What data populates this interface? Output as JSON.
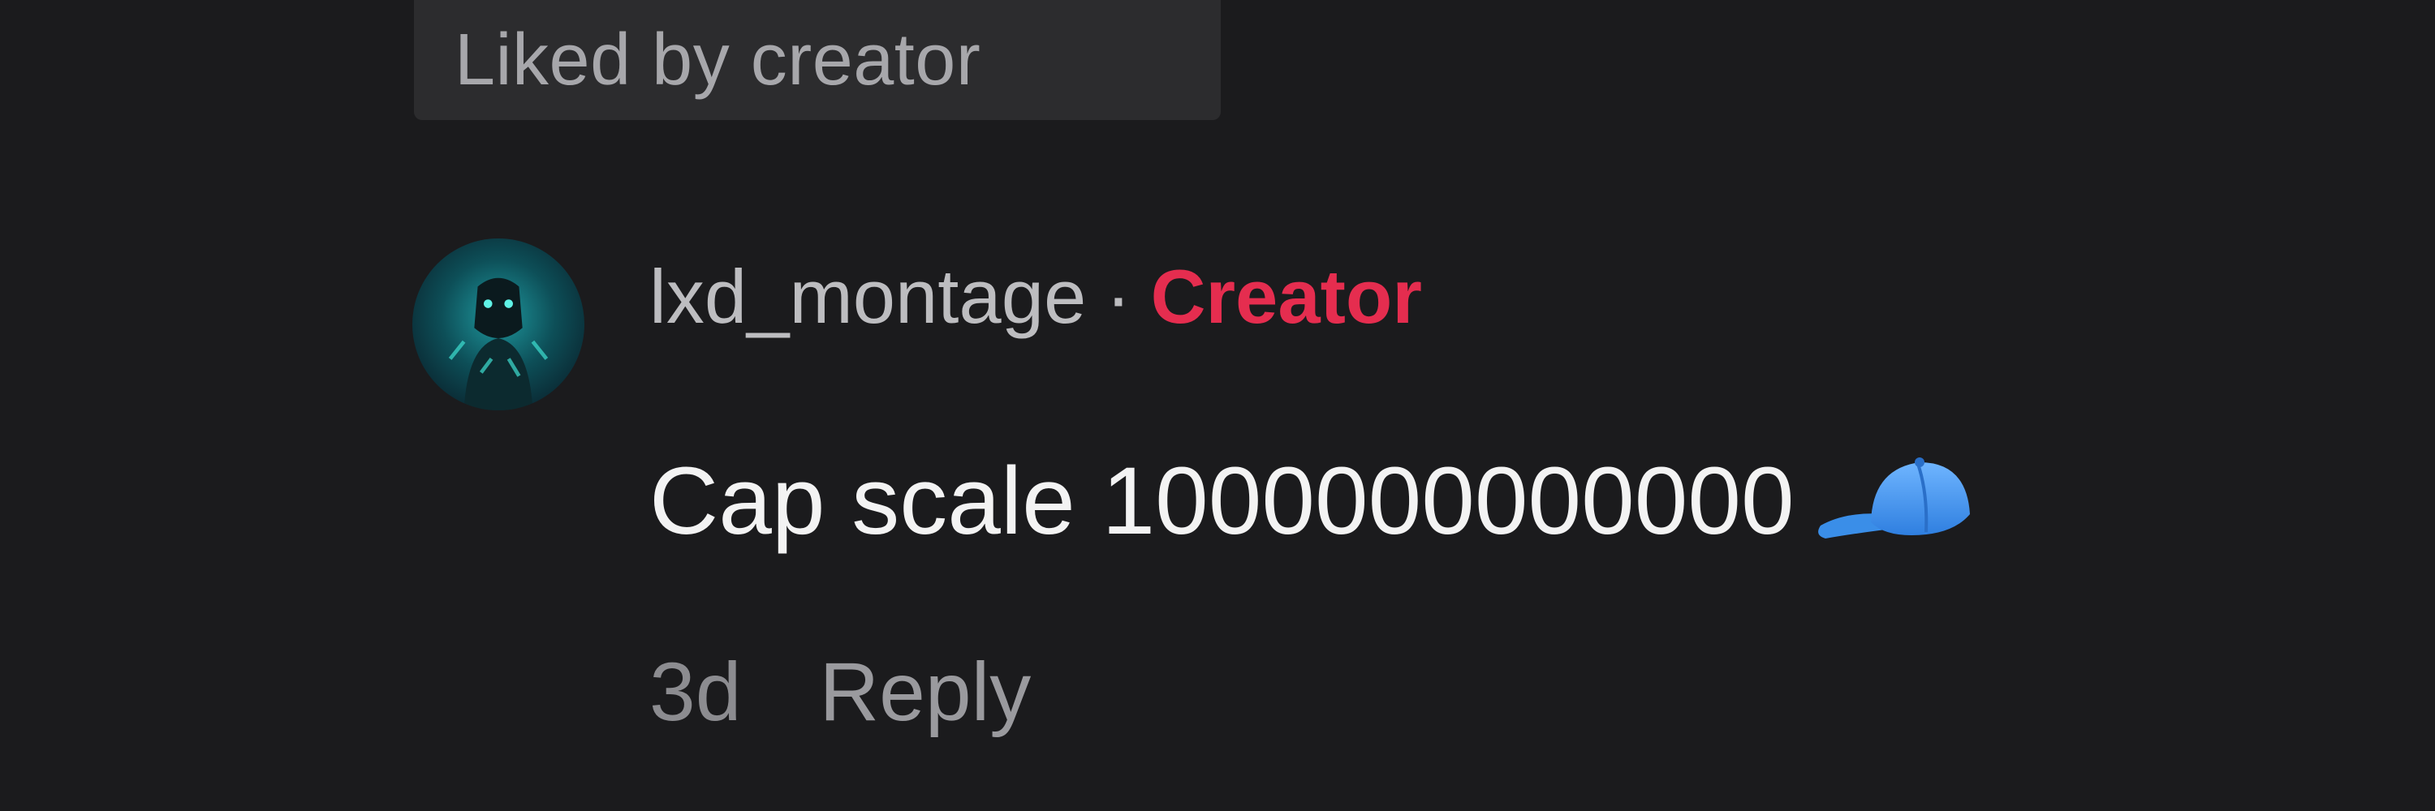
{
  "liked_badge": {
    "label": "Liked by creator"
  },
  "comment": {
    "username": "lxd_montage",
    "separator": "·",
    "creator_label": "Creator",
    "text": "Cap scale 1000000000000",
    "emoji_icon": "blue-cap-icon",
    "time": "3d",
    "reply_label": "Reply"
  },
  "colors": {
    "background": "#1b1b1d",
    "badge_bg": "#2c2c2e",
    "creator_accent": "#e52d4f",
    "text_primary": "#f3f3f3",
    "text_secondary": "#8c8c90"
  }
}
